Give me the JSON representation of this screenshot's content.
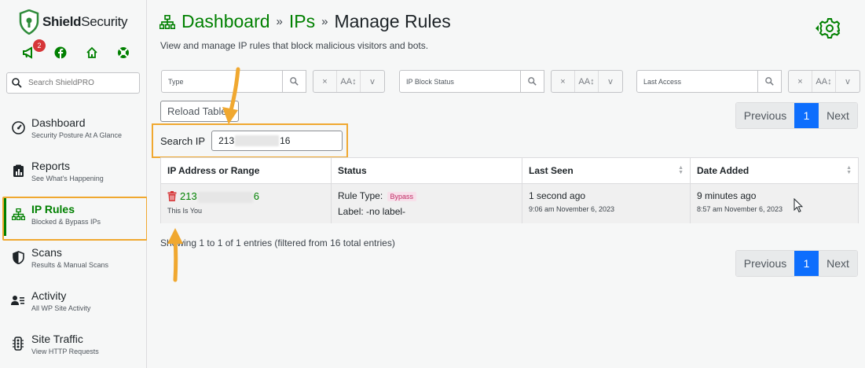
{
  "app": {
    "name_bold": "Shield",
    "name_rest": "Security",
    "notification_count": "2"
  },
  "sidebar": {
    "search_placeholder": "Search ShieldPRO",
    "items": [
      {
        "title": "Dashboard",
        "subtitle": "Security Posture At A Glance"
      },
      {
        "title": "Reports",
        "subtitle": "See What's Happening"
      },
      {
        "title": "IP Rules",
        "subtitle": "Blocked & Bypass IPs"
      },
      {
        "title": "Scans",
        "subtitle": "Results & Manual Scans"
      },
      {
        "title": "Activity",
        "subtitle": "All WP Site Activity"
      },
      {
        "title": "Site Traffic",
        "subtitle": "View HTTP Requests"
      }
    ]
  },
  "header": {
    "crumbs": [
      "Dashboard",
      "IPs"
    ],
    "separator": "»",
    "current": "Manage Rules",
    "subtitle": "View and manage IP rules that block malicious visitors and bots."
  },
  "filters": [
    {
      "placeholder": "Type"
    },
    {
      "placeholder": "IP Block Status"
    },
    {
      "placeholder": "Last Access"
    }
  ],
  "filter_buttons": {
    "clear": "×",
    "case": "AA↕",
    "dropdown": "v"
  },
  "toolbar": {
    "reload_label": "Reload Table"
  },
  "pagination": {
    "previous": "Previous",
    "page": "1",
    "next": "Next"
  },
  "search_ip": {
    "label": "Search IP",
    "value_start": "213",
    "value_end": "16"
  },
  "table": {
    "headers": [
      "IP Address or Range",
      "Status",
      "Last Seen",
      "Date Added"
    ],
    "rows": [
      {
        "ip_start": "213",
        "ip_end": "6",
        "ip_note": "This Is You",
        "rule_type_label": "Rule Type:",
        "rule_type": "Bypass",
        "label": "Label: -no label-",
        "last_seen": "1 second ago",
        "last_seen_date": "9:06 am November 6, 2023",
        "date_added": "9 minutes ago",
        "date_added_date": "8:57 am November 6, 2023"
      }
    ]
  },
  "table_info": "Showing 1 to 1 of 1 entries (filtered from 16 total entries)",
  "colors": {
    "brand_green": "#008000",
    "highlight_orange": "#f0a830",
    "page_active_blue": "#0d6efd",
    "bypass_pink": "#c02b64"
  }
}
